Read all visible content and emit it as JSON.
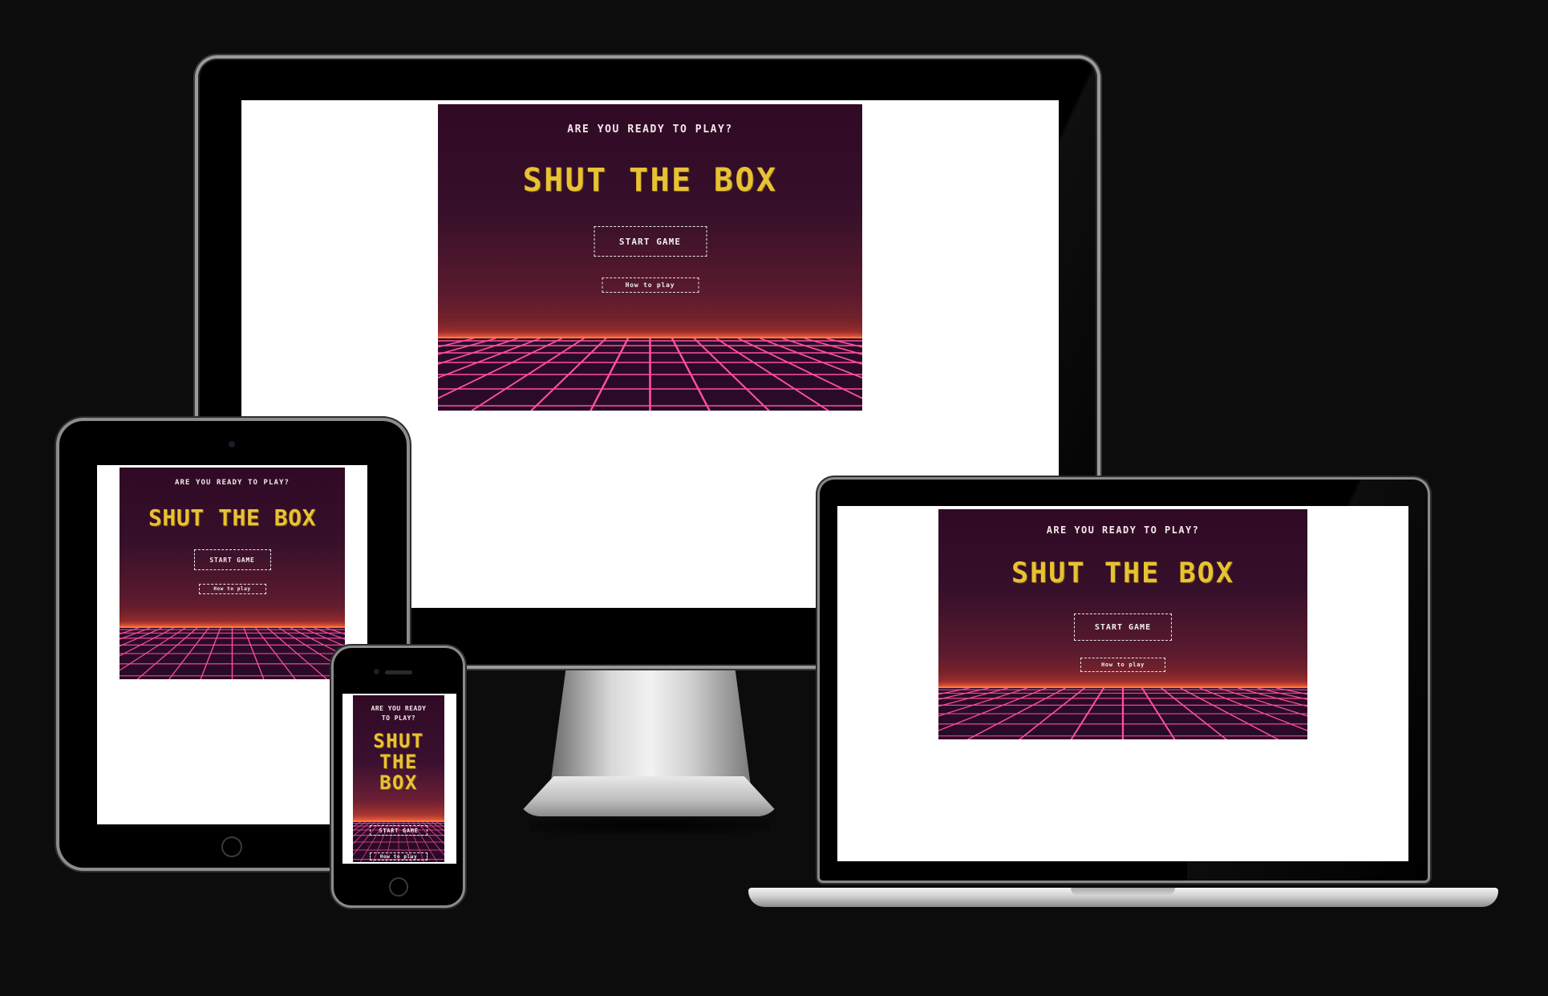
{
  "hero": {
    "tagline": "ARE YOU READY TO PLAY?",
    "tagline_line1": "ARE YOU READY",
    "tagline_line2": "TO PLAY?",
    "title": "SHUT THE BOX",
    "title_line1": "SHUT",
    "title_line2": "THE",
    "title_line3": "BOX",
    "start_button": "START GAME",
    "howto_button": "How to play"
  },
  "colors": {
    "background": "#0c0c0c",
    "title": "#e8c233",
    "grid": "#ff4fa0",
    "horizon": "#ff7a3a",
    "sky_top": "#300a24"
  },
  "devices": [
    "monitor",
    "tablet",
    "laptop",
    "phone"
  ]
}
